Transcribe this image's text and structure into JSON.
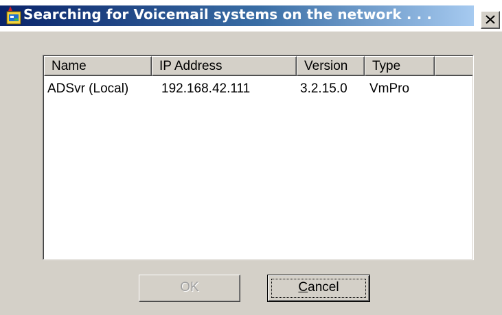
{
  "window": {
    "title": "Searching for Voicemail systems on the network . . .",
    "close_symbol": "✕",
    "title_bar_color": "#0a246a",
    "title_bar_gradient_end": "#a6caf0"
  },
  "list": {
    "columns": [
      "Name",
      "IP Address",
      "Version",
      "Type",
      ""
    ],
    "rows": [
      {
        "name": "ADSvr (Local)",
        "ip": "192.168.42.111",
        "version": "3.2.15.0",
        "type": "VmPro"
      }
    ]
  },
  "buttons": {
    "ok_label": "OK",
    "ok_enabled": false,
    "cancel_mnemonic": "C",
    "cancel_rest": "ancel"
  },
  "icons": {
    "app": "voicemail-app-icon",
    "close": "close-icon"
  },
  "colors": {
    "face": "#d4d0c8",
    "list_background": "#ffffff",
    "disabled_text": "#a0a0a0"
  }
}
